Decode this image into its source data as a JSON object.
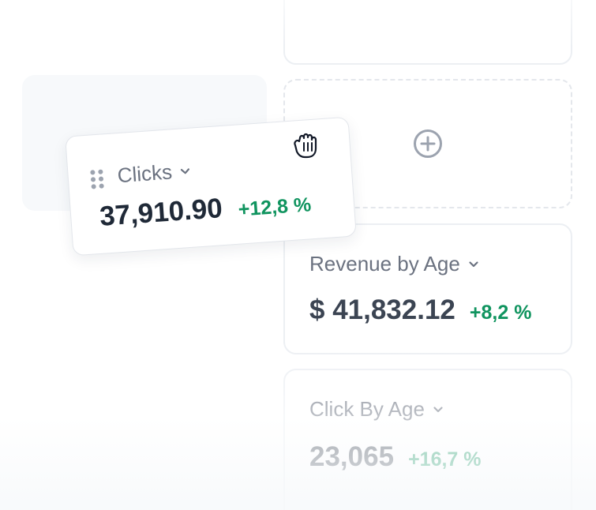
{
  "dragged_card": {
    "title": "Clicks",
    "value": "37,910.90",
    "change": "+12,8 %"
  },
  "revenue_card": {
    "title": "Revenue by Age",
    "value": "$ 41,832.12",
    "change": "+8,2 %"
  },
  "click_age_card": {
    "title": "Click By Age",
    "value": "23,065",
    "change": "+16,7 %"
  },
  "icons": {
    "add": "plus-circle-icon",
    "chevron": "chevron-down-icon",
    "handle": "drag-handle-icon",
    "cursor": "grab-hand-icon"
  },
  "colors": {
    "positive": "#10945f",
    "text_primary": "#1f2937",
    "text_muted": "#6b7280",
    "border": "#eceff3"
  }
}
